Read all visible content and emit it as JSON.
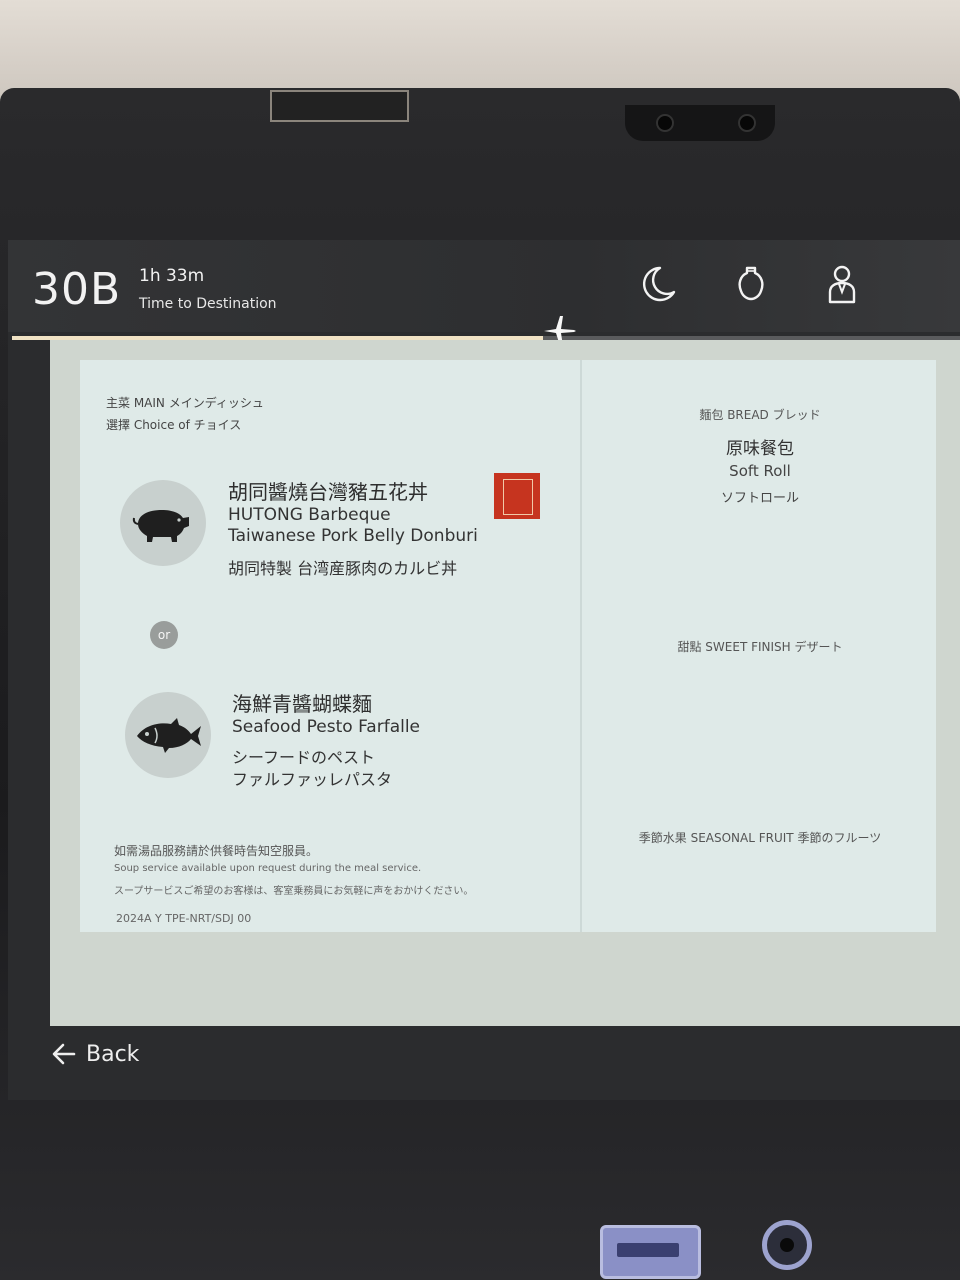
{
  "status": {
    "seat": "30B",
    "time_remaining": "1h 33m",
    "time_label": "Time to Destination",
    "flight_progress": 0.56
  },
  "toolbar": {
    "icons": [
      "moon-icon",
      "light-bulb-icon",
      "attendant-call-icon"
    ]
  },
  "menu": {
    "main": {
      "heading": "主菜 MAIN メインディッシュ",
      "subheading": "選擇 Choice of チョイス",
      "dishes": [
        {
          "name_zh": "胡同醬燒台灣豬五花丼",
          "name_en_1": "HUTONG Barbeque",
          "name_en_2": "Taiwanese Pork Belly Donburi",
          "name_ja": "胡同特製 台湾産豚肉のカルビ丼",
          "icon": "pig-icon"
        },
        {
          "name_zh": "海鮮青醬蝴蝶麵",
          "name_en_1": "Seafood Pesto Farfalle",
          "name_ja_1": "シーフードのペスト",
          "name_ja_2": "ファルファッレパスタ",
          "icon": "fish-icon"
        }
      ],
      "or_label": "or"
    },
    "bread": {
      "heading": "麵包 BREAD ブレッド",
      "item_zh": "原味餐包",
      "item_en": "Soft Roll",
      "item_ja": "ソフトロール"
    },
    "dessert": {
      "heading": "甜點 SWEET FINISH デザート"
    },
    "fruit": {
      "heading": "季節水果 SEASONAL FRUIT 季節のフルーツ"
    },
    "notes": {
      "zh": "如需湯品服務請於供餐時告知空服員。",
      "en": "Soup service available upon request during the meal service.",
      "ja": "スープサービスご希望のお客様は、客室乗務員にお気軽に声をおかけください。",
      "code": "2024A Y TPE-NRT/SDJ 00"
    }
  },
  "nav": {
    "back_label": "Back"
  },
  "colors": {
    "menu_card": "#dfeae8",
    "brand_badge": "#c6341f",
    "progress": "#f0e2c4"
  }
}
